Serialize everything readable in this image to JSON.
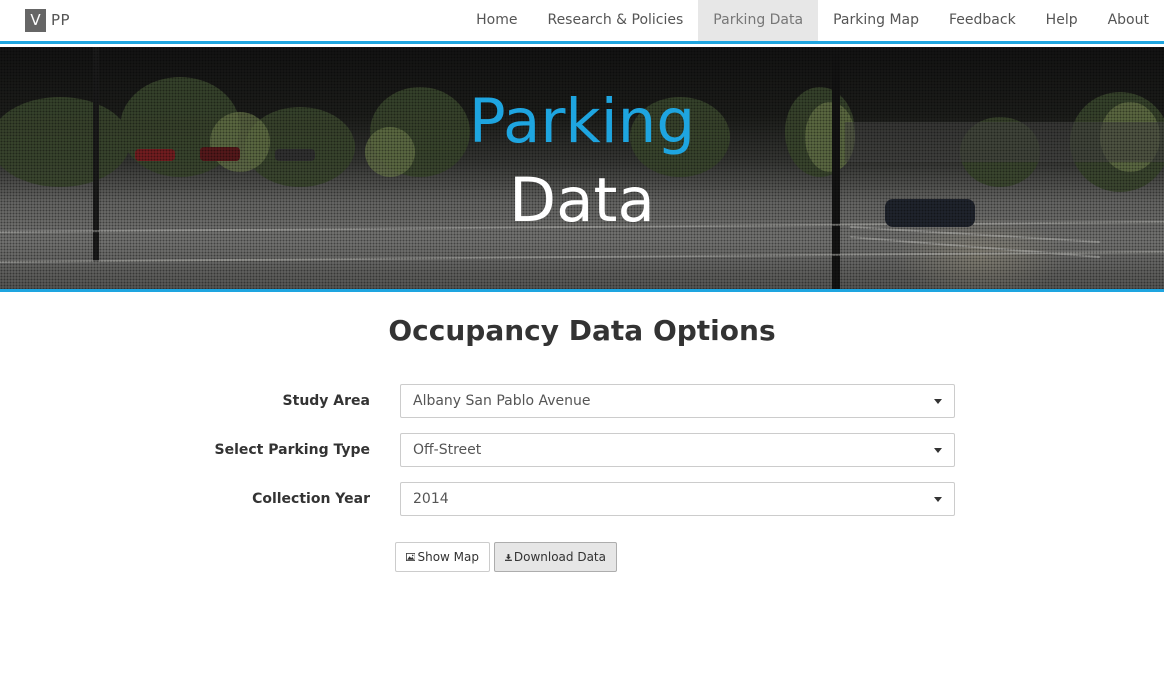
{
  "brand": {
    "mark": "V",
    "text": "PP"
  },
  "nav": {
    "items": [
      {
        "label": "Home"
      },
      {
        "label": "Research & Policies"
      },
      {
        "label": "Parking Data",
        "active": true
      },
      {
        "label": "Parking Map"
      },
      {
        "label": "Feedback"
      },
      {
        "label": "Help"
      },
      {
        "label": "About"
      }
    ]
  },
  "hero": {
    "line1": "Parking",
    "line2": "Data"
  },
  "page": {
    "title": "Occupancy Data Options"
  },
  "form": {
    "study_area": {
      "label": "Study Area",
      "value": "Albany San Pablo Avenue"
    },
    "parking_type": {
      "label": "Select Parking Type",
      "value": "Off-Street"
    },
    "collection_year": {
      "label": "Collection Year",
      "value": "2014"
    }
  },
  "buttons": {
    "show_map": "Show Map",
    "download": "Download Data"
  },
  "colors": {
    "accent": "#1ea5e0",
    "active_nav_bg": "#e7e7e7"
  },
  "icons": {
    "map": "image-icon",
    "download": "download-icon",
    "dropdown": "caret-down-icon"
  }
}
